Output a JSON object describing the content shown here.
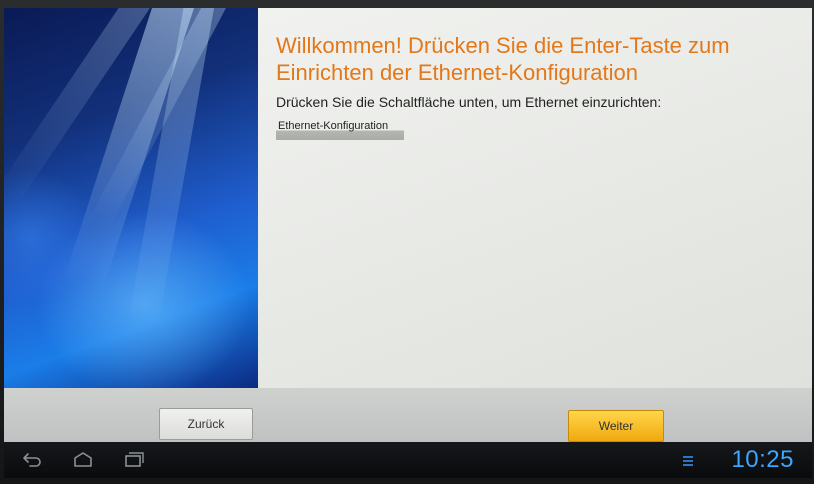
{
  "wizard": {
    "title": "Willkommen! Drücken Sie die Enter-Taste zum Einrichten der Ethernet-Konfiguration",
    "subtitle": "Drücken Sie die Schaltfläche unten, um Ethernet einzurichten:",
    "option_label": "Ethernet-Konfiguration",
    "back_label": "Zurück",
    "next_label": "Weiter"
  },
  "system_bar": {
    "clock": "10:25",
    "icons": [
      "back-icon",
      "home-icon",
      "recent-apps-icon",
      "notification-icon"
    ]
  },
  "colors": {
    "title_orange": "#e3781a",
    "next_button": "#f5b820",
    "clock_blue": "#3aa6ff"
  }
}
